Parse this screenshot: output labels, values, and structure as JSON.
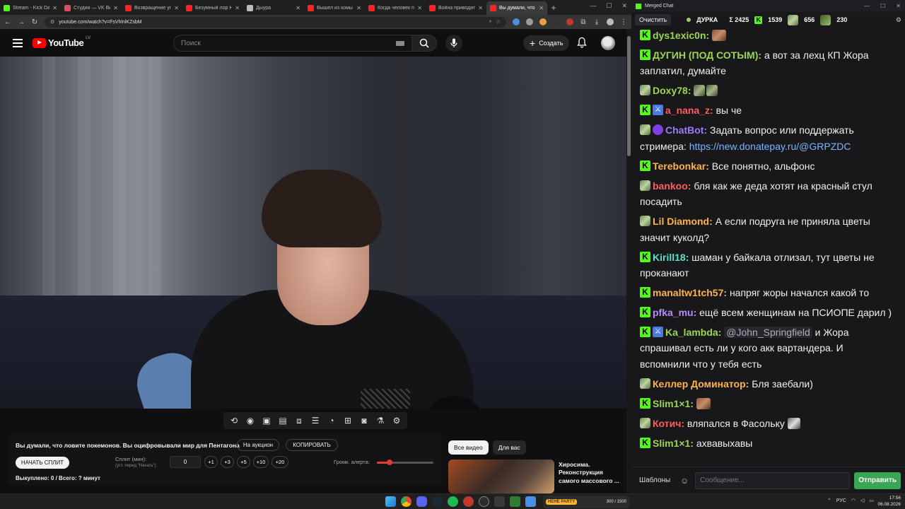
{
  "browser": {
    "tabs": [
      {
        "title": "Stream - Kick Dash",
        "color": "#53fc18",
        "active": false
      },
      {
        "title": "Студия — VK Видео",
        "color": "#e04a6a",
        "active": false
      },
      {
        "title": "Возвращение упорт",
        "color": "#ff2222",
        "active": false
      },
      {
        "title": "Безумный лор Ни",
        "color": "#ff2222",
        "active": false
      },
      {
        "title": "Дыура",
        "color": "#bbbbbb",
        "active": false
      },
      {
        "title": "Вышел из комы",
        "color": "#ff2222",
        "active": false
      },
      {
        "title": "Когда человек по",
        "color": "#ff2222",
        "active": false
      },
      {
        "title": "Война приводит",
        "color": "#ff2222",
        "active": false
      },
      {
        "title": "Вы думали, что ло",
        "color": "#ff2222",
        "active": true
      }
    ],
    "url": "youtube.com/watch?v=FsVhlnlKZsbM"
  },
  "youtube": {
    "logo_text": "YouTube",
    "region": "LV",
    "search_placeholder": "Поиск",
    "create_label": "Создать"
  },
  "split": {
    "title": "Вы думали, что ловите покемонов. Вы оцифровывали мир для Пентагона",
    "auction_label": "На аукцион",
    "copy_label": "КОПИРОВАТЬ",
    "start_label": "НАЧАТЬ СПЛИТ",
    "split_min_label": "Сплит (мин):",
    "split_min_hint": "(уст. перед \"Начать\")",
    "split_value": "0",
    "steps": [
      "+1",
      "+3",
      "+5",
      "+10",
      "+20"
    ],
    "alert_label": "Громк. алерта:",
    "alert_level": 0.22,
    "footer": "Выкуплено: 0 / Всего: ? минут"
  },
  "recommendations": {
    "chips": [
      {
        "label": "Все видео",
        "active": true
      },
      {
        "label": "Для вас",
        "active": false
      }
    ],
    "first_title": "Хиросима. Реконструкция самого массового ..."
  },
  "chat": {
    "window_title": "Merged Chat",
    "clear_label": "Очистить",
    "channel": "ДУРКА",
    "total": "Σ 2425",
    "kick_count": "1539",
    "twitch_count": "656",
    "other_count": "230",
    "messages": [
      {
        "badges": [
          "kick"
        ],
        "user": "dys1exic0n",
        "color": "#9cd64f",
        "parts": [
          {
            "emote": "face"
          }
        ]
      },
      {
        "badges": [
          "kick"
        ],
        "user": "ДУГИН (ПОД СОТЫМ)",
        "color": "#9cd64f",
        "parts": [
          {
            "text": "а вот за лехц КП Жора заплатил, думайте"
          }
        ]
      },
      {
        "badges": [
          "twitch"
        ],
        "user": "Doxy78",
        "color": "#9cd64f",
        "parts": [
          {
            "emote": "frog"
          },
          {
            "emote": "frog"
          }
        ]
      },
      {
        "badges": [
          "kick",
          "vip"
        ],
        "user": "a_nana_z",
        "color": "#ff5c5c",
        "parts": [
          {
            "text": "вы че"
          }
        ]
      },
      {
        "badges": [
          "twitch",
          "bot"
        ],
        "user": "ChatBot",
        "color": "#9b7bff",
        "parts": [
          {
            "text": "Задать вопрос или поддержать стримера: "
          },
          {
            "link": "https://new.donatepay.ru/@GRPZDC"
          }
        ]
      },
      {
        "badges": [
          "kick"
        ],
        "user": "Terebonkar",
        "color": "#ffb347",
        "parts": [
          {
            "text": "Все понятно, альфонс"
          }
        ]
      },
      {
        "badges": [
          "twitch"
        ],
        "user": "bankoo",
        "color": "#ff5c5c",
        "parts": [
          {
            "text": "бля как же деда хотят на красный стул посадить"
          }
        ]
      },
      {
        "badges": [
          "twitch"
        ],
        "user": "Lil Diamond",
        "color": "#ffb347",
        "parts": [
          {
            "text": "А если подруга не приняла цветы значит куколд?"
          }
        ]
      },
      {
        "badges": [
          "kick"
        ],
        "user": "Kirill18",
        "color": "#5ce0c8",
        "parts": [
          {
            "text": "шаман у байкала отлизал, тут цветы не проканают"
          }
        ]
      },
      {
        "badges": [
          "kick"
        ],
        "user": "manaltw1tch57",
        "color": "#ffb347",
        "parts": [
          {
            "text": "напряг жоры начался какой то"
          }
        ]
      },
      {
        "badges": [
          "kick"
        ],
        "user": "pfka_mu",
        "color": "#b78bff",
        "parts": [
          {
            "text": "ещё всем женщинам на ПСИОПЕ дарил )"
          }
        ]
      },
      {
        "badges": [
          "kick",
          "vip"
        ],
        "user": "Ka_lambda",
        "color": "#9cd64f",
        "parts": [
          {
            "mention": "@John_Springfield"
          },
          {
            "text": " и Жора спрашивал есть ли у кого акк вартандера. И вспомнили что у тебя есть"
          }
        ]
      },
      {
        "badges": [
          "twitch"
        ],
        "user": "Келлер Доминатор",
        "color": "#ffb347",
        "parts": [
          {
            "text": "Бля заебали)"
          }
        ]
      },
      {
        "badges": [
          "kick"
        ],
        "user": "Slim1×1",
        "color": "#9cd64f",
        "parts": [
          {
            "emote": "face"
          }
        ]
      },
      {
        "badges": [
          "twitch"
        ],
        "user": "Котич",
        "color": "#ff5c5c",
        "parts": [
          {
            "text": "вляпался в Фасольку "
          },
          {
            "emote": "cat"
          }
        ]
      },
      {
        "badges": [
          "kick"
        ],
        "user": "Slim1×1",
        "color": "#9cd64f",
        "parts": [
          {
            "text": "ахвавыхавы"
          }
        ]
      }
    ],
    "templates_label": "Шаблоны",
    "input_placeholder": "Сообщение...",
    "send_label": "Отправить"
  },
  "taskbar": {
    "widget_label": "HEHE PARTY",
    "widget_value": "300 / 1500",
    "lang": "РУС",
    "time": "17:56",
    "date": "06.08.2026"
  }
}
